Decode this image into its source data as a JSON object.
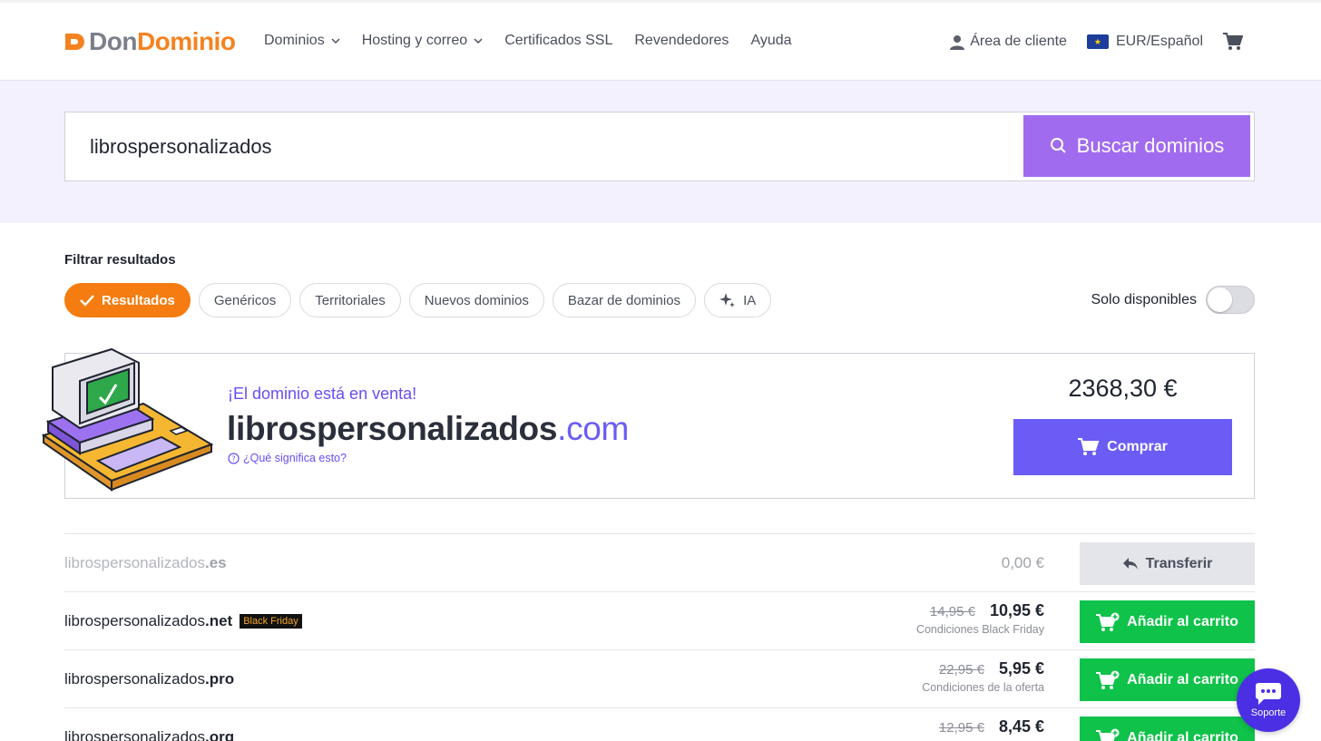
{
  "header": {
    "logo_don": "Don",
    "logo_dominio": "Dominio",
    "nav": [
      {
        "label": "Dominios",
        "dropdown": true
      },
      {
        "label": "Hosting y correo",
        "dropdown": true
      },
      {
        "label": "Certificados SSL",
        "dropdown": false
      },
      {
        "label": "Revendedores",
        "dropdown": false
      },
      {
        "label": "Ayuda",
        "dropdown": false
      }
    ],
    "client_area": "Área de cliente",
    "currency_language": "EUR/Español",
    "icons": {
      "user": "user-icon",
      "flag": "eu-flag-icon",
      "cart": "cart-icon"
    }
  },
  "search": {
    "value": "librospersonalizados",
    "button_label": "Buscar dominios"
  },
  "filters": {
    "title": "Filtrar resultados",
    "chips": [
      {
        "label": "Resultados",
        "active": true
      },
      {
        "label": "Genéricos",
        "active": false
      },
      {
        "label": "Territoriales",
        "active": false
      },
      {
        "label": "Nuevos dominios",
        "active": false
      },
      {
        "label": "Bazar de dominios",
        "active": false
      },
      {
        "label": "IA",
        "active": false
      }
    ],
    "only_available_label": "Solo disponibles",
    "only_available": false
  },
  "featured": {
    "sale_label": "¡El dominio está en venta!",
    "domain_name": "librospersonalizados",
    "domain_tld": ".com",
    "help_link": "¿Qué significa esto?",
    "price": "2368,30 €",
    "buy_label": "Comprar"
  },
  "results": [
    {
      "name": "librospersonalizados",
      "tld": ".es",
      "status": "transfer",
      "price": "0,00 €",
      "button": "Transferir"
    },
    {
      "name": "librospersonalizados",
      "tld": ".net",
      "badge": "Black Friday",
      "old_price": "14,95 €",
      "price": "10,95 €",
      "note": "Condiciones Black Friday",
      "button": "Añadir al carrito"
    },
    {
      "name": "librospersonalizados",
      "tld": ".pro",
      "old_price": "22,95 €",
      "price": "5,95 €",
      "note": "Condiciones de la oferta",
      "button": "Añadir al carrito"
    },
    {
      "name": "librospersonalizados",
      "tld": ".org",
      "old_price": "12,95 €",
      "price": "8,45 €",
      "button": "Añadir al carrito"
    }
  ],
  "support": {
    "label": "Soporte"
  },
  "colors": {
    "brand_orange": "#f58220",
    "search_button": "#a16bf0",
    "buy_button": "#6a5cf5",
    "add_button": "#0fc24a",
    "support_bubble": "#4b2fe4"
  }
}
